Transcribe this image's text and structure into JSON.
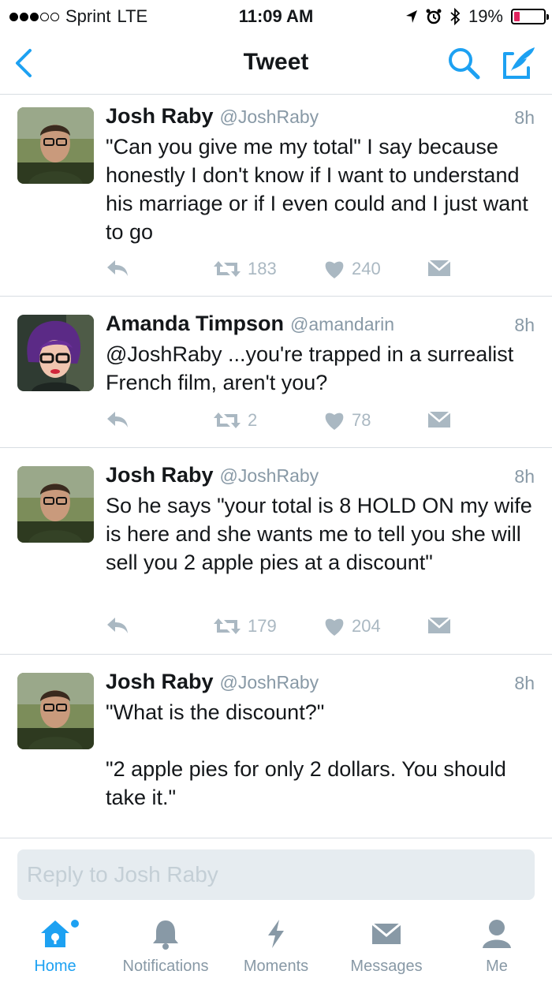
{
  "status_bar": {
    "carrier": "Sprint",
    "network": "LTE",
    "time": "11:09 AM",
    "battery": "19%",
    "battery_level": 0.19
  },
  "nav": {
    "title": "Tweet"
  },
  "tweets": [
    {
      "name": "Josh Raby",
      "handle": "@JoshRaby",
      "time": "8h",
      "text": "\"Can you give me my total\" I say because honestly I don't know if I want to understand his marriage or if I even could and I just want to go",
      "retweets": "183",
      "likes": "240"
    },
    {
      "name": "Amanda Timpson",
      "handle": "@amandarin",
      "time": "8h",
      "text": "@JoshRaby ...you're trapped in a surrealist French film, aren't you?",
      "retweets": "2",
      "likes": "78"
    },
    {
      "name": "Josh Raby",
      "handle": "@JoshRaby",
      "time": "8h",
      "text": "So he says \"your total is 8 HOLD ON my wife is here and she wants me to tell you she will sell you 2 apple pies at a discount\"",
      "retweets": "179",
      "likes": "204"
    },
    {
      "name": "Josh Raby",
      "handle": "@JoshRaby",
      "time": "8h",
      "text": "\"What is the discount?\"\n\n\"2 apple pies for only 2 dollars. You should take it.\""
    }
  ],
  "reply": {
    "placeholder": "Reply to Josh Raby"
  },
  "tabbar": {
    "home": "Home",
    "notifications": "Notifications",
    "moments": "Moments",
    "messages": "Messages",
    "me": "Me"
  },
  "colors": {
    "accent": "#1da1f2",
    "muted": "#8899a6",
    "action_gray": "#aab8c2",
    "battery_low": "#e0245e"
  }
}
